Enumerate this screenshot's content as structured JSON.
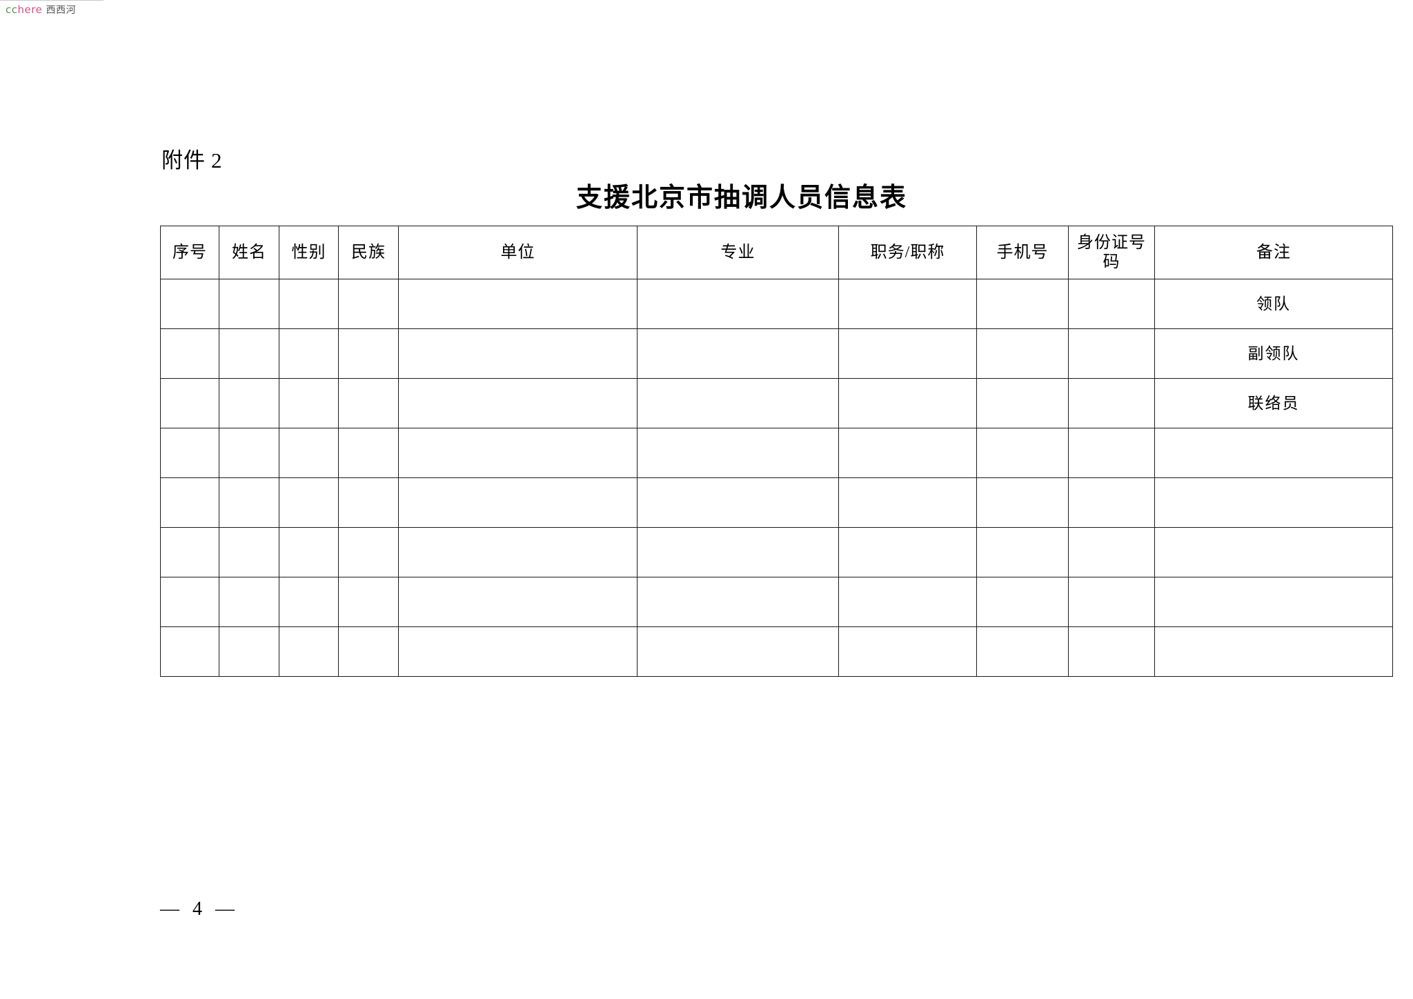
{
  "watermark": {
    "part_cc": "cc",
    "part_here": "here",
    "part_cn": "西西河",
    "color_cc": "#5b8f4e",
    "color_here": "#d34f86",
    "color_cn": "#555555"
  },
  "document": {
    "attachment_label": "附件",
    "attachment_number": "2",
    "title": "支援北京市抽调人员信息表",
    "page_number": "— 4 —"
  },
  "table": {
    "columns": [
      {
        "key": "seq",
        "label": "序号"
      },
      {
        "key": "name",
        "label": "姓名"
      },
      {
        "key": "gender",
        "label": "性别"
      },
      {
        "key": "ethnic",
        "label": "民族"
      },
      {
        "key": "unit",
        "label": "单位"
      },
      {
        "key": "major",
        "label": "专业"
      },
      {
        "key": "title",
        "label": "职务/职称"
      },
      {
        "key": "phone",
        "label": "手机号"
      },
      {
        "key": "idcard",
        "label": "身份证号码"
      },
      {
        "key": "remark",
        "label": "备注"
      }
    ],
    "rows": [
      {
        "seq": "",
        "name": "",
        "gender": "",
        "ethnic": "",
        "unit": "",
        "major": "",
        "title": "",
        "phone": "",
        "idcard": "",
        "remark": "领队"
      },
      {
        "seq": "",
        "name": "",
        "gender": "",
        "ethnic": "",
        "unit": "",
        "major": "",
        "title": "",
        "phone": "",
        "idcard": "",
        "remark": "副领队"
      },
      {
        "seq": "",
        "name": "",
        "gender": "",
        "ethnic": "",
        "unit": "",
        "major": "",
        "title": "",
        "phone": "",
        "idcard": "",
        "remark": "联络员"
      },
      {
        "seq": "",
        "name": "",
        "gender": "",
        "ethnic": "",
        "unit": "",
        "major": "",
        "title": "",
        "phone": "",
        "idcard": "",
        "remark": ""
      },
      {
        "seq": "",
        "name": "",
        "gender": "",
        "ethnic": "",
        "unit": "",
        "major": "",
        "title": "",
        "phone": "",
        "idcard": "",
        "remark": ""
      },
      {
        "seq": "",
        "name": "",
        "gender": "",
        "ethnic": "",
        "unit": "",
        "major": "",
        "title": "",
        "phone": "",
        "idcard": "",
        "remark": ""
      },
      {
        "seq": "",
        "name": "",
        "gender": "",
        "ethnic": "",
        "unit": "",
        "major": "",
        "title": "",
        "phone": "",
        "idcard": "",
        "remark": ""
      },
      {
        "seq": "",
        "name": "",
        "gender": "",
        "ethnic": "",
        "unit": "",
        "major": "",
        "title": "",
        "phone": "",
        "idcard": "",
        "remark": ""
      }
    ]
  }
}
